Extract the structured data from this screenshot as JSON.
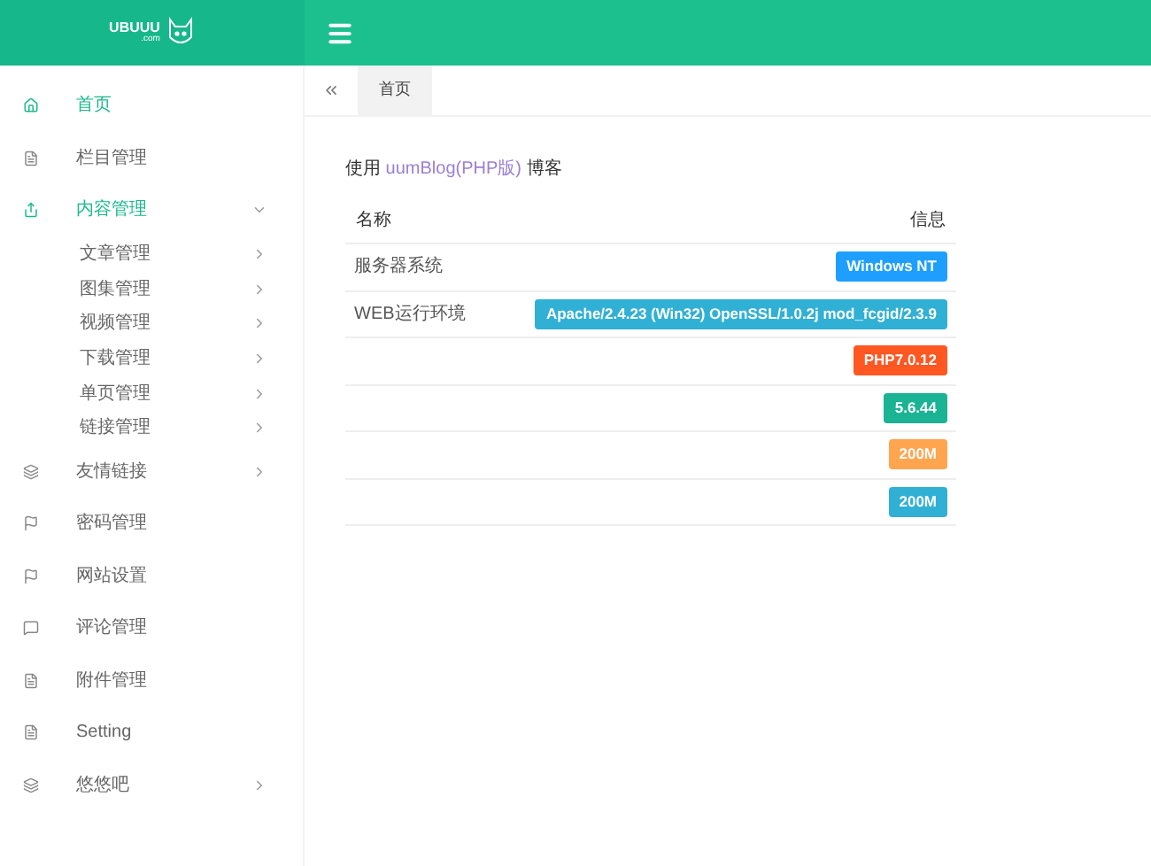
{
  "logo": {
    "name": "UBUUU",
    "domain": ".com"
  },
  "sidebar": {
    "items": [
      {
        "label": "首页",
        "kind": "home",
        "selected": true
      },
      {
        "label": "栏目管理",
        "kind": "doc",
        "selected": false
      },
      {
        "label": "内容管理",
        "kind": "share",
        "selected": true,
        "expanded": true,
        "children": [
          {
            "label": "文章管理"
          },
          {
            "label": "图集管理"
          },
          {
            "label": "视频管理"
          },
          {
            "label": "下载管理"
          },
          {
            "label": "单页管理"
          },
          {
            "label": "链接管理"
          }
        ]
      },
      {
        "label": "友情链接",
        "kind": "layers",
        "selected": false,
        "expanded": false
      },
      {
        "label": "密码管理",
        "kind": "flag",
        "selected": false
      },
      {
        "label": "网站设置",
        "kind": "flag",
        "selected": false
      },
      {
        "label": "评论管理",
        "kind": "comment",
        "selected": false
      },
      {
        "label": "附件管理",
        "kind": "doc",
        "selected": false
      },
      {
        "label": "Setting",
        "kind": "doc",
        "selected": false
      },
      {
        "label": "悠悠吧",
        "kind": "layers",
        "selected": false,
        "expanded": false
      }
    ]
  },
  "tabs": [
    {
      "label": "首页",
      "selected": true
    }
  ],
  "intro": {
    "before": "使用",
    "link": "uumBlog(PHP版)",
    "after": "博客"
  },
  "table": {
    "columns": [
      "名称",
      "信息"
    ],
    "rows": [
      {
        "name": "服务器系统",
        "info": "Windows NT",
        "color": "#1e9fff"
      },
      {
        "name": "WEB运行环境",
        "info": "Apache/2.4.23 (Win32) OpenSSL/1.0.2j mod_fcgid/2.3.9",
        "color": "#31b0d5"
      },
      {
        "info": "PHP7.0.12",
        "color": "#ff5722"
      },
      {
        "info": "5.6.44",
        "color": "#1ab394"
      },
      {
        "info": "200M",
        "color": "#ffa54f"
      },
      {
        "info": "200M",
        "color": "#31b0d5"
      }
    ]
  }
}
